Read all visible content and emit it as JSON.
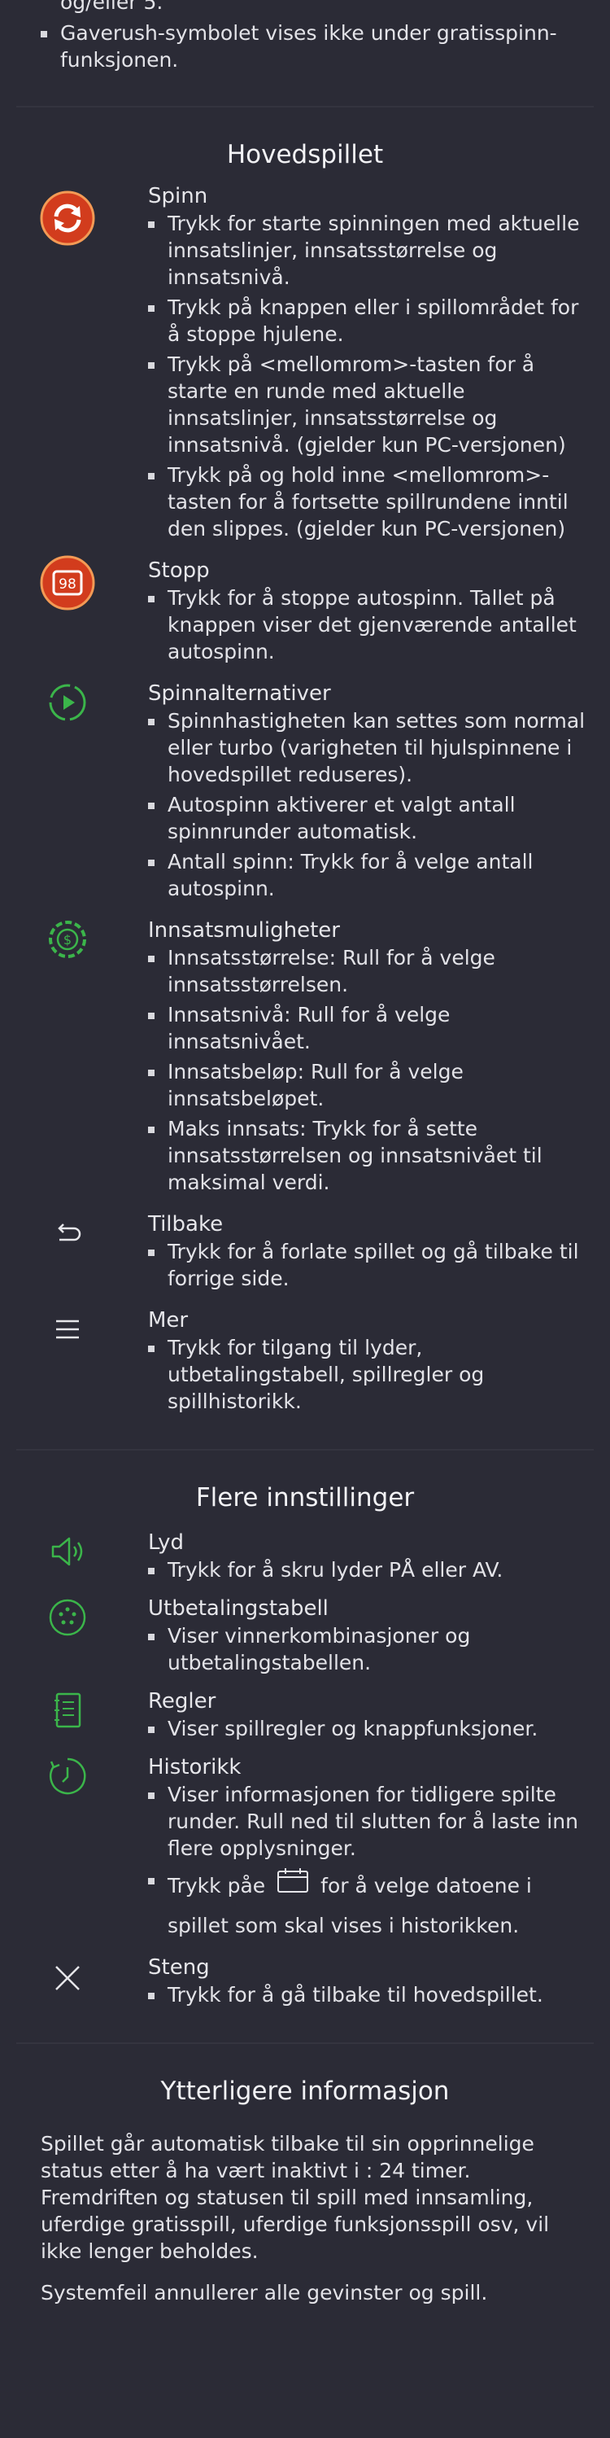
{
  "top": {
    "fragment": "og/eller 5.",
    "bullet": "Gaverush-symbolet vises ikke under gratisspinn-funksjonen."
  },
  "main": {
    "title": "Hovedspillet",
    "spin": {
      "title": "Spinn",
      "bullets": [
        "Trykk for starte spinningen med aktuelle innsatslinjer, innsatsstørrelse og innsatsnivå.",
        "Trykk på knappen eller i spillområdet for å stoppe hjulene.",
        "Trykk på <mellomrom>-tasten for å starte en runde med aktuelle innsatslinjer, innsatsstørrelse og innsatsnivå. (gjelder kun PC-versjonen)",
        "Trykk på og hold inne <mellomrom>-tasten for å fortsette spillrundene inntil den slippes. (gjelder kun PC-versjonen)"
      ]
    },
    "stop": {
      "title": "Stopp",
      "badge": "98",
      "bullets": [
        "Trykk for å stoppe autospinn. Tallet på knappen viser det gjenværende antallet autospinn."
      ]
    },
    "spin_options": {
      "title": "Spinnalternativer",
      "bullets": [
        "Spinnhastigheten kan settes som normal eller turbo (varigheten til hjulspinnene i hovedspillet reduseres).",
        "Autospinn aktiverer et valgt antall spinnrunder automatisk.",
        "Antall spinn: Trykk for å velge antall autospinn."
      ]
    },
    "bet_options": {
      "title": "Innsatsmuligheter",
      "icon_symbol": "$",
      "bullets": [
        "Innsatsstørrelse: Rull for å velge innsatsstørrelsen.",
        "Innsatsnivå: Rull for å velge innsatsnivået.",
        "Innsatsbeløp: Rull for å velge innsatsbeløpet.",
        "Maks innsats: Trykk for å sette innsatsstørrelsen og innsatsnivået til maksimal verdi."
      ]
    },
    "back": {
      "title": "Tilbake",
      "bullets": [
        "Trykk for å forlate spillet og gå tilbake til forrige side."
      ]
    },
    "more": {
      "title": "Mer",
      "bullets": [
        "Trykk for tilgang til lyder, utbetalingstabell, spillregler og spillhistorikk."
      ]
    }
  },
  "settings": {
    "title": "Flere innstillinger",
    "sound": {
      "title": "Lyd",
      "bullets": [
        "Trykk for å skru lyder PÅ eller AV."
      ]
    },
    "paytable": {
      "title": "Utbetalingstabell",
      "bullets": [
        "Viser vinnerkombinasjoner og utbetalingstabellen."
      ]
    },
    "rules": {
      "title": "Regler",
      "bullets": [
        "Viser spillregler og knappfunksjoner."
      ]
    },
    "history": {
      "title": "Historikk",
      "bullets": [
        "Viser informasjonen for tidligere spilte runder. Rull ned til slutten for å laste inn flere opplysninger."
      ],
      "date_before": "Trykk påe",
      "date_after": "for å velge datoene i",
      "date_line2": "spillet som skal vises i historikken."
    },
    "close": {
      "title": "Steng",
      "bullets": [
        "Trykk for å gå tilbake til hovedspillet."
      ]
    }
  },
  "info": {
    "title": "Ytterligere informasjon",
    "p1": "Spillet går automatisk tilbake til sin opprinnelige status etter å ha vært inaktivt i : 24 timer. Fremdriften og statusen til spill med innsamling, uferdige gratisspill, uferdige funksjonsspill osv, vil ikke lenger beholdes.",
    "p2": "Systemfeil annullerer alle gevinster og spill."
  },
  "colors": {
    "background": "#2b2b36",
    "accent_green": "#3bb54a",
    "accent_red": "#d8401f"
  }
}
